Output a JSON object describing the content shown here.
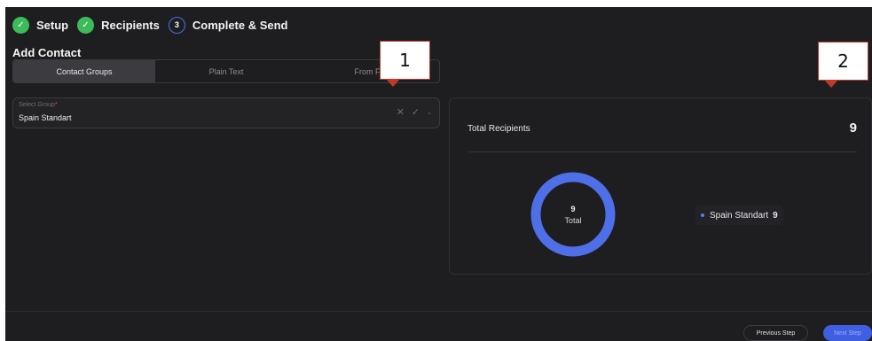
{
  "stepper": {
    "steps": [
      {
        "label": "Setup",
        "status": "done",
        "icon": "check-icon"
      },
      {
        "label": "Recipients",
        "status": "done",
        "icon": "check-icon"
      },
      {
        "label": "Complete & Send",
        "status": "current",
        "number": "3"
      }
    ]
  },
  "add_contact": {
    "title": "Add Contact",
    "tabs": [
      {
        "label": "Contact Groups",
        "active": true
      },
      {
        "label": "Plain Text",
        "active": false
      },
      {
        "label": "From Fi",
        "active": false
      }
    ],
    "select": {
      "label": "Select Group",
      "required_mark": "*",
      "value": "Spain Standart",
      "icons": [
        "close-icon",
        "check-icon",
        "chevron-down-icon"
      ]
    }
  },
  "summary": {
    "title": "Total Recipients",
    "count": "9",
    "donut": {
      "value": "9",
      "label": "Total",
      "color": "#4f6fe8"
    },
    "legend": [
      {
        "name": "Spain Standart",
        "value": "9",
        "color": "#5b7cf0"
      }
    ]
  },
  "footer": {
    "previous_label": "Previous Step",
    "next_label": "Next Step"
  },
  "annotations": [
    {
      "label": "1"
    },
    {
      "label": "2"
    }
  ],
  "colors": {
    "background": "#1e1e20",
    "success": "#3dbb5b",
    "accent": "#3f5fe0",
    "annotation_border": "#c0392b"
  }
}
